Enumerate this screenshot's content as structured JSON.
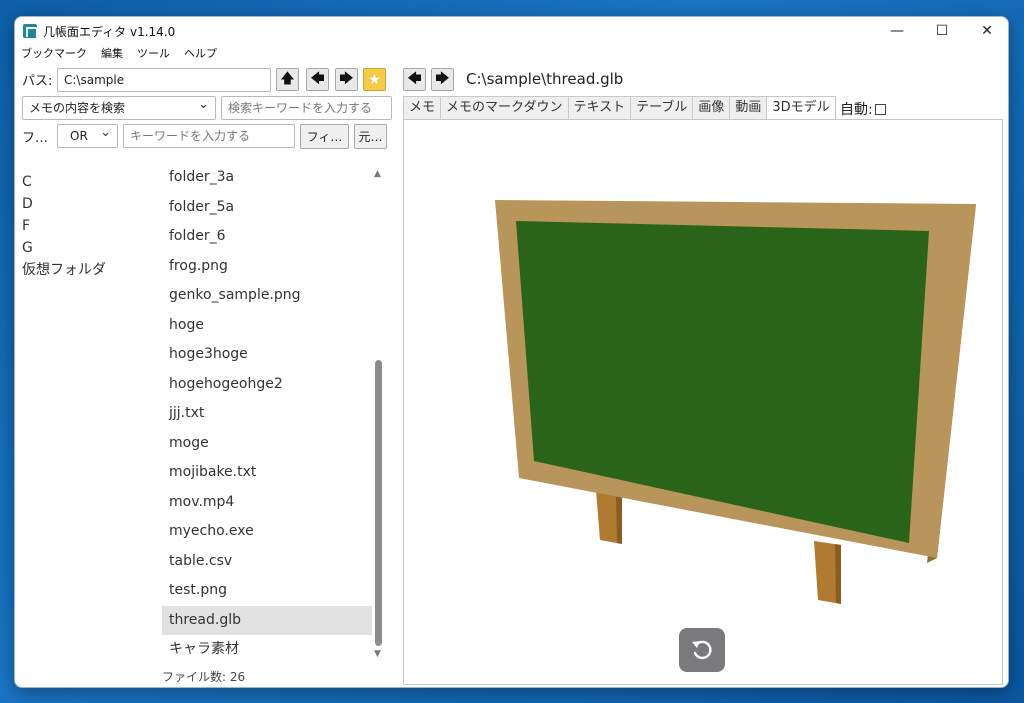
{
  "window": {
    "title": "几帳面エディタ v1.14.0"
  },
  "window_controls": {
    "minimize": "—",
    "maximize": "☐",
    "close": "✕"
  },
  "menu": [
    "ブックマーク",
    "編集",
    "ツール",
    "ヘルプ"
  ],
  "path_bar": {
    "label": "パス:",
    "value": "C:\\sample"
  },
  "search": {
    "mode_selected": "メモの内容を検索",
    "keyword_placeholder": "検索キーワードを入力する"
  },
  "filter": {
    "label": "フ…",
    "operator_selected": "OR",
    "keyword_placeholder": "キーワードを入力する",
    "filter_button": "フィ…",
    "restore_button": "元…"
  },
  "drives": [
    "C",
    "D",
    "F",
    "G",
    "仮想フォルダ"
  ],
  "files": [
    "folder_3a",
    "folder_5a",
    "folder_6",
    "frog.png",
    "genko_sample.png",
    "hoge",
    "hoge3hoge",
    "hogehogeohge2",
    "jjj.txt",
    "moge",
    "mojibake.txt",
    "mov.mp4",
    "myecho.exe",
    "table.csv",
    "test.png",
    "thread.glb",
    "キャラ素材"
  ],
  "selected_file": "thread.glb",
  "file_count": "ファイル数: 26",
  "viewer": {
    "current_path": "C:\\sample\\thread.glb",
    "tabs": [
      "メモ",
      "メモのマークダウン",
      "テキスト",
      "テーブル",
      "画像",
      "動画",
      "3Dモデル"
    ],
    "active_tab": "3Dモデル",
    "auto_label": "自動:"
  },
  "colors": {
    "board_frame": "#b8955a",
    "board_surface": "#2a6418",
    "board_legs": "#b07a30",
    "star_button": "#f5cc4a",
    "selected_row": "#e2e2e2"
  },
  "icons": {
    "up": "up-arrow-icon",
    "back": "left-arrow-icon",
    "forward": "right-arrow-icon",
    "bookmark": "star-icon",
    "reset_view": "rotate-reset-icon"
  }
}
